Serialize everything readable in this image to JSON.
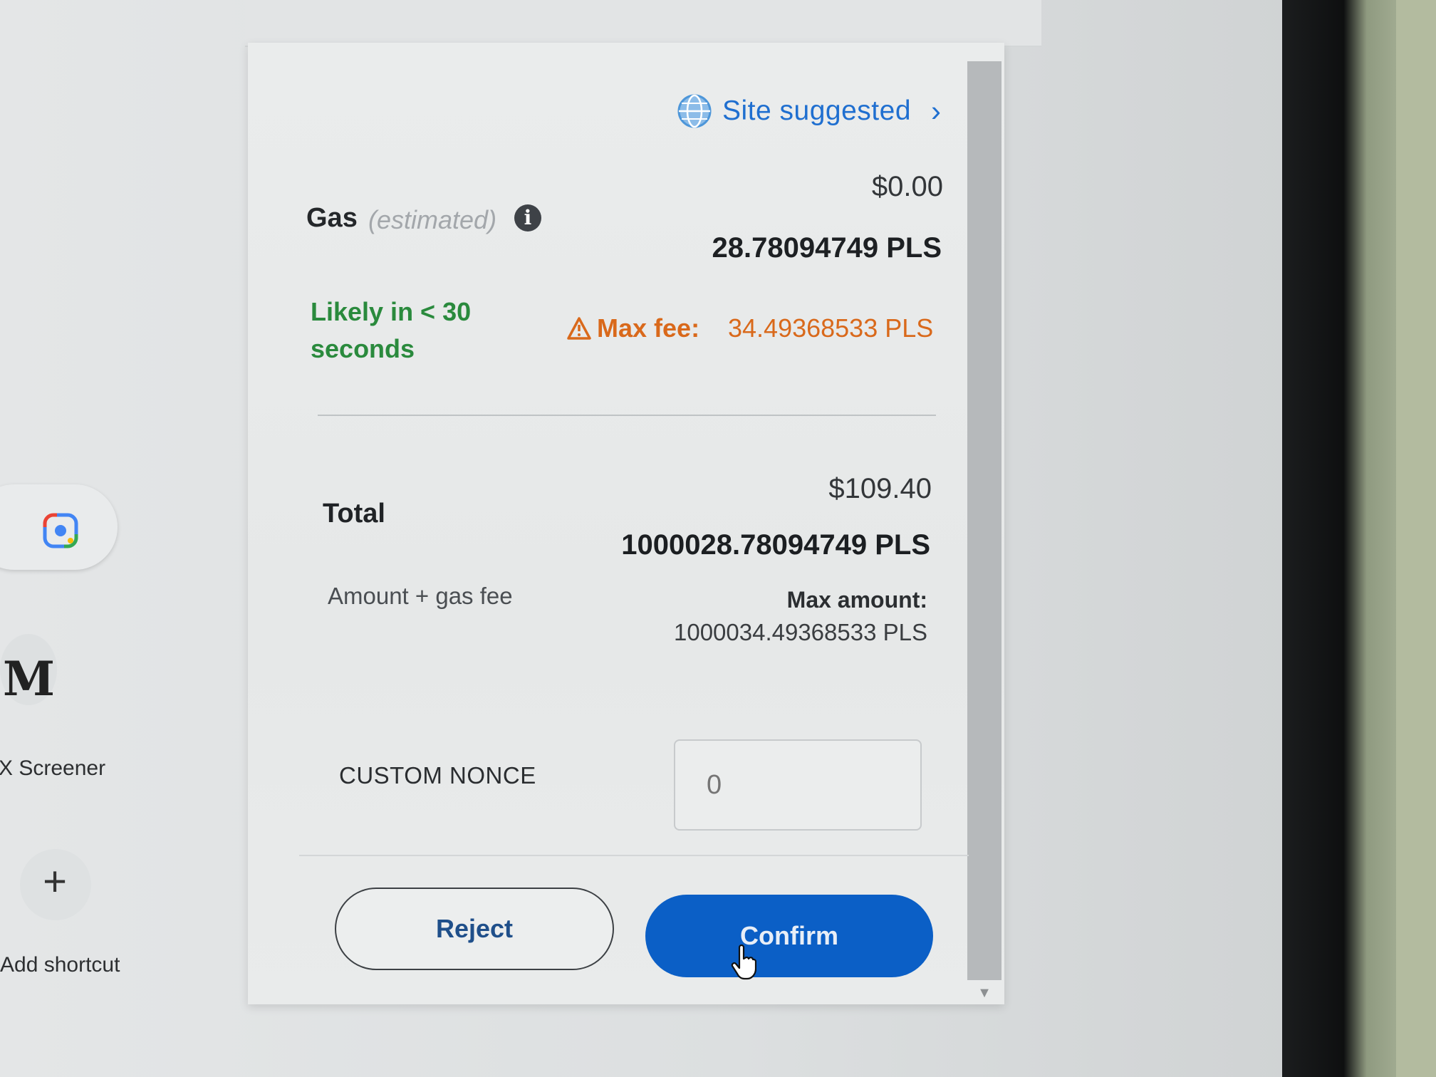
{
  "browser": {
    "shortcuts": [
      {
        "label": "X Screener",
        "icon": "screener-logo-icon",
        "glyph": "M"
      },
      {
        "label": "Add shortcut",
        "icon": "plus-icon",
        "glyph": "+"
      }
    ]
  },
  "gas": {
    "site_suggested": "Site suggested",
    "label": "Gas",
    "estimated": "(estimated)",
    "info_glyph": "i",
    "fiat": "$0.00",
    "native": "28.78094749 PLS",
    "likely": "Likely in < 30 seconds",
    "max_fee_label": "Max fee:",
    "max_fee_value": "34.49368533 PLS"
  },
  "total": {
    "label": "Total",
    "fiat": "$109.40",
    "native": "1000028.78094749 PLS",
    "subtext": "Amount + gas fee",
    "max_amount_label": "Max amount:",
    "max_amount_value": "1000034.49368533 PLS"
  },
  "nonce": {
    "label": "CUSTOM NONCE",
    "placeholder": "0"
  },
  "actions": {
    "reject": "Reject",
    "confirm": "Confirm"
  },
  "colors": {
    "accent": "#0b5fc6",
    "link": "#1f6fd0",
    "success": "#2a8a3d",
    "warning": "#d9691b"
  }
}
